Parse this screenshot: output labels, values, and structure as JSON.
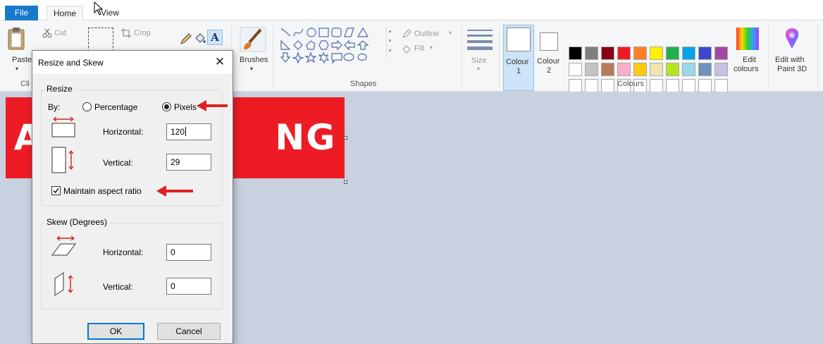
{
  "tabs": {
    "file": "File",
    "home": "Home",
    "view": "View"
  },
  "ribbon": {
    "clipboard": {
      "paste": "Paste",
      "cut": "Cut",
      "group_label_partial": "Cli"
    },
    "image": {
      "crop": "Crop"
    },
    "brushes": "Brushes",
    "shapes": {
      "outline": "Outline",
      "fill": "Fill",
      "group_label": "Shapes"
    },
    "size": "Size",
    "colours": {
      "colour1": [
        "Colour",
        "1"
      ],
      "colour2": [
        "Colour",
        "2"
      ],
      "edit_colours": [
        "Edit",
        "colours"
      ],
      "group_label": "Colours",
      "palette_row1": [
        "#000000",
        "#7f7f7f",
        "#880015",
        "#ed1c24",
        "#ff7f27",
        "#fff200",
        "#22b14c",
        "#00a2e8",
        "#3f48cc",
        "#a349a4"
      ],
      "palette_row2": [
        "#ffffff",
        "#c3c3c3",
        "#b97a57",
        "#ffaec9",
        "#ffc90e",
        "#efe4b0",
        "#b5e61d",
        "#99d9ea",
        "#7092be",
        "#c8bfe7"
      ]
    },
    "paint3d": [
      "Edit with",
      "Paint 3D"
    ]
  },
  "canvas": {
    "image_text": "A                 NG",
    "image_color": "#ed1c24"
  },
  "dialog": {
    "title": "Resize and Skew",
    "resize": {
      "legend": "Resize",
      "by_label": "By:",
      "percentage_label": "Percentage",
      "pixels_label": "Pixels",
      "selected_unit": "Pixels",
      "horizontal_label": "Horizontal:",
      "horizontal_value": "120",
      "vertical_label": "Vertical:",
      "vertical_value": "29",
      "maintain_label": "Maintain aspect ratio",
      "maintain_checked": true
    },
    "skew": {
      "legend": "Skew (Degrees)",
      "horizontal_label": "Horizontal:",
      "horizontal_value": "0",
      "vertical_label": "Vertical:",
      "vertical_value": "0"
    },
    "ok": "OK",
    "cancel": "Cancel"
  }
}
